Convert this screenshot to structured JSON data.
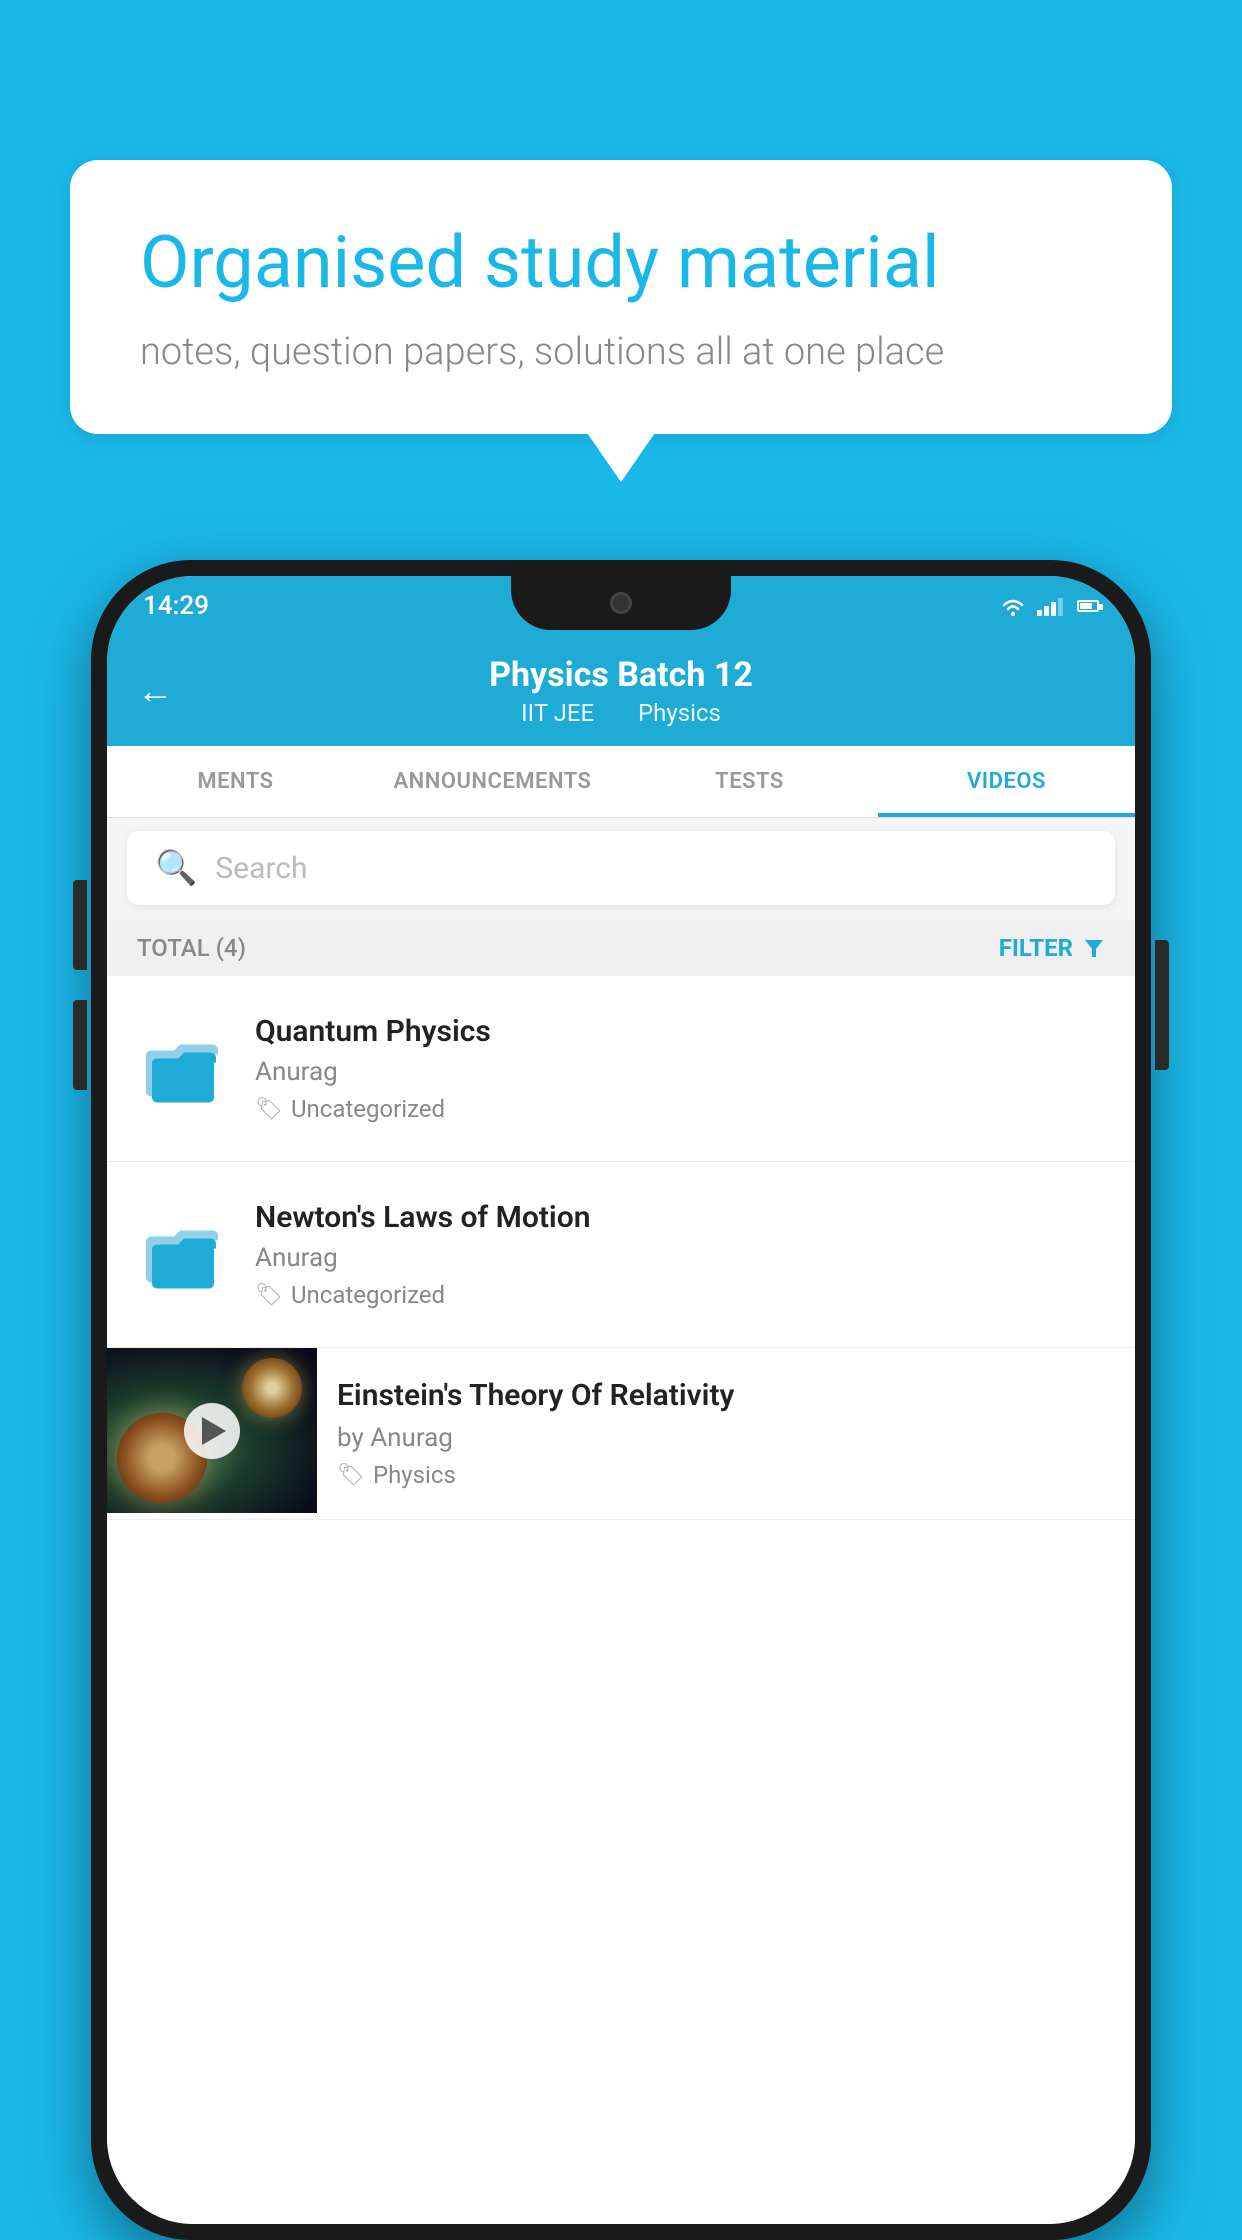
{
  "background_color": "#1ab8e8",
  "speech_bubble": {
    "title": "Organised study material",
    "subtitle": "notes, question papers, solutions all at one place"
  },
  "status_bar": {
    "time": "14:29",
    "icons": [
      "wifi",
      "signal",
      "battery"
    ]
  },
  "header": {
    "back_label": "←",
    "title": "Physics Batch 12",
    "subtitle1": "IIT JEE",
    "subtitle2": "Physics"
  },
  "tabs": [
    {
      "label": "MENTS",
      "active": false
    },
    {
      "label": "ANNOUNCEMENTS",
      "active": false
    },
    {
      "label": "TESTS",
      "active": false
    },
    {
      "label": "VIDEOS",
      "active": true
    }
  ],
  "search": {
    "placeholder": "Search"
  },
  "filter_bar": {
    "total_label": "TOTAL (4)",
    "filter_label": "FILTER"
  },
  "list_items": [
    {
      "id": "quantum-physics",
      "title": "Quantum Physics",
      "author": "Anurag",
      "tag": "Uncategorized",
      "type": "folder"
    },
    {
      "id": "newtons-laws",
      "title": "Newton's Laws of Motion",
      "author": "Anurag",
      "tag": "Uncategorized",
      "type": "folder"
    },
    {
      "id": "einsteins-theory",
      "title": "Einstein's Theory Of Relativity",
      "author": "by Anurag",
      "tag": "Physics",
      "type": "video"
    }
  ]
}
